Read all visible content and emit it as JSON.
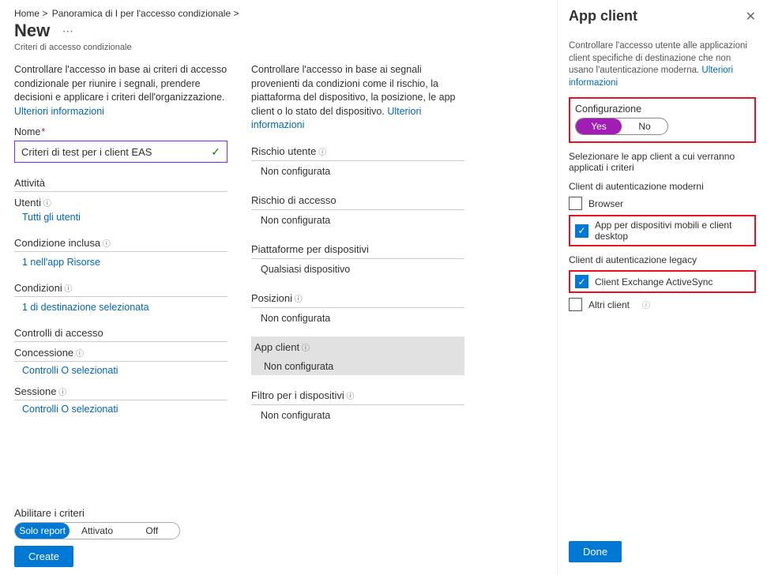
{
  "breadcrumb": {
    "home": "Home >",
    "overview": "Panoramica di I per l'accesso condizionale >"
  },
  "page": {
    "title": "New",
    "subtitle": "Criteri di accesso condizionale"
  },
  "col1": {
    "desc_prefix": "Controllare l'accesso in base ai criteri di accesso condizionale per riunire i segnali, prendere decisioni e applicare i criteri dell'organizzazione. ",
    "desc_link": "Ulteriori informazioni",
    "name_label": "Nome",
    "name_value": "Criteri di test per i client EAS",
    "activity_title": "Attività",
    "users_label": "Utenti",
    "users_value": "Tutti gli utenti",
    "included_label": "Condizione inclusa",
    "included_value": "1 nell'app Risorse",
    "conditions_label": "Condizioni",
    "conditions_value": "1 di destinazione selezionata",
    "access_title": "Controlli di accesso",
    "grant_label": "Concessione",
    "grant_value": "Controlli O selezionati",
    "session_label": "Sessione",
    "session_value": "Controlli O selezionati"
  },
  "col2": {
    "desc_prefix": "Controllare l'accesso in base ai segnali provenienti da condizioni come il rischio, la piattaforma del dispositivo, la posizione, le app client o lo stato del dispositivo. ",
    "desc_link": "Ulteriori informazioni",
    "items": [
      {
        "title": "Rischio utente",
        "value": "Non configurata",
        "info": true
      },
      {
        "title": "Rischio di accesso",
        "value": "Non configurata",
        "info": false
      },
      {
        "title": "Piattaforme per dispositivi",
        "value": "Qualsiasi dispositivo",
        "info": false
      },
      {
        "title": "Posizioni",
        "value": "Non configurata",
        "info": true
      },
      {
        "title": "App client",
        "value": "Non configurata",
        "info": true,
        "selected": true
      },
      {
        "title": "Filtro per i dispositivi",
        "value": "Non configurata",
        "info": true
      }
    ]
  },
  "bottom": {
    "enable_label": "Abilitare i criteri",
    "opts": [
      "Solo report",
      "Attivato",
      "Off"
    ],
    "create": "Create"
  },
  "rpanel": {
    "title": "App client",
    "desc_prefix": "Controllare l'accesso utente alle applicazioni client specifiche di destinazione che non usano l'autenticazione moderna. ",
    "desc_link": "Ulteriori informazioni",
    "config_label": "Configurazione",
    "yes": "Yes",
    "no": "No",
    "select_text": "Selezionare le app client a cui verranno applicati i criteri",
    "modern_head": "Client di autenticazione moderni",
    "browser": "Browser",
    "mobile": "App per dispositivi mobili e client desktop",
    "legacy_head": "Client di autenticazione legacy",
    "eas": "Client Exchange ActiveSync",
    "other": "Altri client",
    "done": "Done"
  }
}
